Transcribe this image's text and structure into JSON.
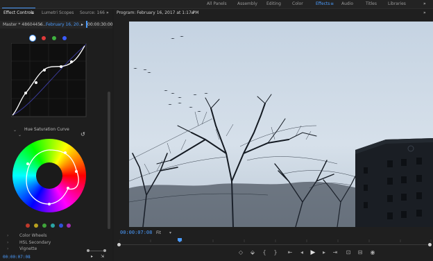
{
  "workspaces": {
    "items": [
      {
        "label": "All Panels"
      },
      {
        "label": "Assembly"
      },
      {
        "label": "Editing"
      },
      {
        "label": "Color"
      },
      {
        "label": "Effects"
      },
      {
        "label": "Audio"
      },
      {
        "label": "Titles"
      },
      {
        "label": "Libraries"
      }
    ],
    "active": "Effects",
    "menu_icon": "hamburger-icon",
    "overflow_icon": "double-chevron-right-icon"
  },
  "left_panel": {
    "tabs": [
      {
        "label": "Effect Controls"
      },
      {
        "label": "Lumetri Scopes"
      },
      {
        "label": "Source: 166"
      }
    ],
    "source_label": "Master * 48604456...",
    "clip_label": "February 16, 20...",
    "timecode_small": "00:00:30:00",
    "curve_channel_colors": [
      "#ffffff",
      "#e03a3a",
      "#3fb23f",
      "#3a5cff"
    ],
    "hue_sat_label": "Hue Saturation Curve",
    "swatch_colors": [
      "#c0392b",
      "#b8a11f",
      "#3fa53a",
      "#2ba5a5",
      "#2f52d8",
      "#a32fb0"
    ],
    "sections": [
      {
        "label": "Color Wheels"
      },
      {
        "label": "HSL Secondary"
      },
      {
        "label": "Vignette"
      }
    ],
    "timecode": "00:00:07:08"
  },
  "program": {
    "title": "Program: February 16, 2017 at 1:17 PM",
    "timecode": "00:00:07:08",
    "fit_label": "Fit",
    "controls": [
      {
        "icon": "marker-icon",
        "glyph": "◇"
      },
      {
        "icon": "mark-in-icon",
        "glyph": "{"
      },
      {
        "icon": "mark-out-icon",
        "glyph": "}"
      },
      {
        "icon": "go-to-in-icon",
        "glyph": "⇤"
      },
      {
        "icon": "step-back-icon",
        "glyph": "◂"
      },
      {
        "icon": "play-icon",
        "glyph": "▶"
      },
      {
        "icon": "step-forward-icon",
        "glyph": "▸"
      },
      {
        "icon": "go-to-out-icon",
        "glyph": "⇥"
      },
      {
        "icon": "lift-icon",
        "glyph": "⊡"
      },
      {
        "icon": "extract-icon",
        "glyph": "⊟"
      },
      {
        "icon": "export-frame-icon",
        "glyph": "◉"
      }
    ]
  }
}
